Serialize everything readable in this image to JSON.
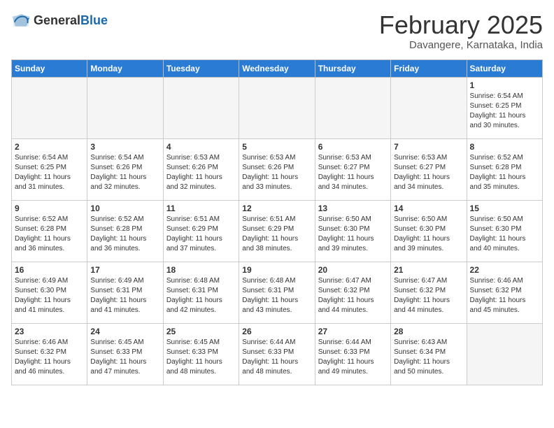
{
  "header": {
    "logo_line1": "General",
    "logo_line2": "Blue",
    "title": "February 2025",
    "subtitle": "Davangere, Karnataka, India"
  },
  "columns": [
    "Sunday",
    "Monday",
    "Tuesday",
    "Wednesday",
    "Thursday",
    "Friday",
    "Saturday"
  ],
  "weeks": [
    [
      {
        "day": "",
        "info": ""
      },
      {
        "day": "",
        "info": ""
      },
      {
        "day": "",
        "info": ""
      },
      {
        "day": "",
        "info": ""
      },
      {
        "day": "",
        "info": ""
      },
      {
        "day": "",
        "info": ""
      },
      {
        "day": "1",
        "info": "Sunrise: 6:54 AM\nSunset: 6:25 PM\nDaylight: 11 hours\nand 30 minutes."
      }
    ],
    [
      {
        "day": "2",
        "info": "Sunrise: 6:54 AM\nSunset: 6:25 PM\nDaylight: 11 hours\nand 31 minutes."
      },
      {
        "day": "3",
        "info": "Sunrise: 6:54 AM\nSunset: 6:26 PM\nDaylight: 11 hours\nand 32 minutes."
      },
      {
        "day": "4",
        "info": "Sunrise: 6:53 AM\nSunset: 6:26 PM\nDaylight: 11 hours\nand 32 minutes."
      },
      {
        "day": "5",
        "info": "Sunrise: 6:53 AM\nSunset: 6:26 PM\nDaylight: 11 hours\nand 33 minutes."
      },
      {
        "day": "6",
        "info": "Sunrise: 6:53 AM\nSunset: 6:27 PM\nDaylight: 11 hours\nand 34 minutes."
      },
      {
        "day": "7",
        "info": "Sunrise: 6:53 AM\nSunset: 6:27 PM\nDaylight: 11 hours\nand 34 minutes."
      },
      {
        "day": "8",
        "info": "Sunrise: 6:52 AM\nSunset: 6:28 PM\nDaylight: 11 hours\nand 35 minutes."
      }
    ],
    [
      {
        "day": "9",
        "info": "Sunrise: 6:52 AM\nSunset: 6:28 PM\nDaylight: 11 hours\nand 36 minutes."
      },
      {
        "day": "10",
        "info": "Sunrise: 6:52 AM\nSunset: 6:28 PM\nDaylight: 11 hours\nand 36 minutes."
      },
      {
        "day": "11",
        "info": "Sunrise: 6:51 AM\nSunset: 6:29 PM\nDaylight: 11 hours\nand 37 minutes."
      },
      {
        "day": "12",
        "info": "Sunrise: 6:51 AM\nSunset: 6:29 PM\nDaylight: 11 hours\nand 38 minutes."
      },
      {
        "day": "13",
        "info": "Sunrise: 6:50 AM\nSunset: 6:30 PM\nDaylight: 11 hours\nand 39 minutes."
      },
      {
        "day": "14",
        "info": "Sunrise: 6:50 AM\nSunset: 6:30 PM\nDaylight: 11 hours\nand 39 minutes."
      },
      {
        "day": "15",
        "info": "Sunrise: 6:50 AM\nSunset: 6:30 PM\nDaylight: 11 hours\nand 40 minutes."
      }
    ],
    [
      {
        "day": "16",
        "info": "Sunrise: 6:49 AM\nSunset: 6:30 PM\nDaylight: 11 hours\nand 41 minutes."
      },
      {
        "day": "17",
        "info": "Sunrise: 6:49 AM\nSunset: 6:31 PM\nDaylight: 11 hours\nand 41 minutes."
      },
      {
        "day": "18",
        "info": "Sunrise: 6:48 AM\nSunset: 6:31 PM\nDaylight: 11 hours\nand 42 minutes."
      },
      {
        "day": "19",
        "info": "Sunrise: 6:48 AM\nSunset: 6:31 PM\nDaylight: 11 hours\nand 43 minutes."
      },
      {
        "day": "20",
        "info": "Sunrise: 6:47 AM\nSunset: 6:32 PM\nDaylight: 11 hours\nand 44 minutes."
      },
      {
        "day": "21",
        "info": "Sunrise: 6:47 AM\nSunset: 6:32 PM\nDaylight: 11 hours\nand 44 minutes."
      },
      {
        "day": "22",
        "info": "Sunrise: 6:46 AM\nSunset: 6:32 PM\nDaylight: 11 hours\nand 45 minutes."
      }
    ],
    [
      {
        "day": "23",
        "info": "Sunrise: 6:46 AM\nSunset: 6:32 PM\nDaylight: 11 hours\nand 46 minutes."
      },
      {
        "day": "24",
        "info": "Sunrise: 6:45 AM\nSunset: 6:33 PM\nDaylight: 11 hours\nand 47 minutes."
      },
      {
        "day": "25",
        "info": "Sunrise: 6:45 AM\nSunset: 6:33 PM\nDaylight: 11 hours\nand 48 minutes."
      },
      {
        "day": "26",
        "info": "Sunrise: 6:44 AM\nSunset: 6:33 PM\nDaylight: 11 hours\nand 48 minutes."
      },
      {
        "day": "27",
        "info": "Sunrise: 6:44 AM\nSunset: 6:33 PM\nDaylight: 11 hours\nand 49 minutes."
      },
      {
        "day": "28",
        "info": "Sunrise: 6:43 AM\nSunset: 6:34 PM\nDaylight: 11 hours\nand 50 minutes."
      },
      {
        "day": "",
        "info": ""
      }
    ]
  ]
}
